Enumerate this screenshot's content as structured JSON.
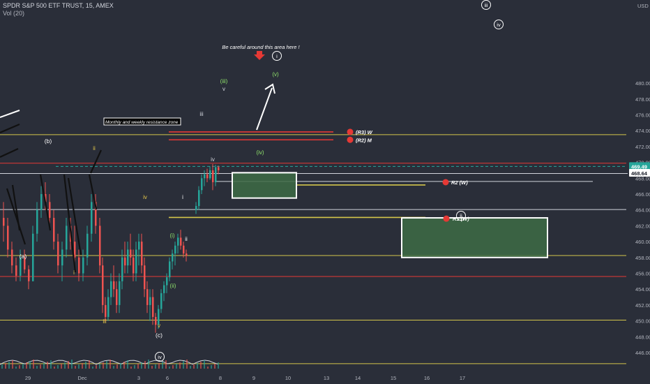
{
  "header": {
    "symbol_line": "SPDR S&P 500 ETF TRUST, 15, AMEX",
    "volume_label": "Vol (20)"
  },
  "colors": {
    "background": "#2a2e39",
    "axis_text": "#b2b5be",
    "yellow_line": "#d4c54a",
    "red_line": "#e53935",
    "white_line": "#d1d4dc",
    "box_fill": "#3d6b45",
    "price_tag": "#26a69a",
    "up_candle": "#26a69a",
    "down_candle": "#ef5350"
  },
  "chart_data": {
    "type": "candlestick",
    "price_axis": {
      "currency": "USD",
      "ticks": [
        446.0,
        448.0,
        450.0,
        452.0,
        454.0,
        456.0,
        458.0,
        460.0,
        462.0,
        464.0,
        466.0,
        468.0,
        470.0,
        472.0,
        474.0,
        476.0,
        478.0,
        480.0
      ],
      "range": [
        444.5,
        481.5
      ]
    },
    "time_axis": {
      "ticks": [
        "29",
        "Dec",
        "3",
        "6",
        "8",
        "9",
        "10",
        "13",
        "14",
        "15",
        "16",
        "17"
      ]
    },
    "price_tags": [
      {
        "value": "469.49",
        "style": "teal"
      },
      {
        "value": "468.64",
        "style": "white"
      }
    ],
    "horizontal_levels": [
      {
        "price": 473.5,
        "color": "yellow"
      },
      {
        "price": 473.85,
        "color": "red",
        "partial": true
      },
      {
        "price": 472.85,
        "color": "red",
        "partial": true
      },
      {
        "price": 469.9,
        "color": "red"
      },
      {
        "price": 469.49,
        "color": "teal-dashed"
      },
      {
        "price": 468.6,
        "color": "white"
      },
      {
        "price": 467.6,
        "color": "white"
      },
      {
        "price": 467.15,
        "color": "yellow",
        "partial": true
      },
      {
        "price": 464.05,
        "color": "white"
      },
      {
        "price": 463.05,
        "color": "yellow",
        "partial": true
      },
      {
        "price": 458.25,
        "color": "yellow"
      },
      {
        "price": 455.6,
        "color": "red"
      },
      {
        "price": 450.1,
        "color": "yellow"
      },
      {
        "price": 444.6,
        "color": "yellow"
      }
    ],
    "zones": [
      {
        "label": "(iv)",
        "price_top": 468.7,
        "price_bottom": 465.5
      },
      {
        "label": "ii",
        "price_top": 463.0,
        "price_bottom": 458.0
      }
    ],
    "annotations": {
      "note": "Be careful around this area here !",
      "resistance": "Monthly and weekly resistance zone",
      "r3w": "(R3) W",
      "r2m": "(R2) M",
      "r2w": "R2 (W)",
      "r1w": "R1 (W)",
      "wave_i_circled": "i",
      "wave_iii_circled": "iii",
      "wave_iv_circled": "iv",
      "wave_v_green": "(v)",
      "wave_iii_green": "(iii)",
      "wave_v_small": "v",
      "wave_iii_small": "iii",
      "wave_iv_small": "iv",
      "wave_b": "(b)",
      "wave_a": "(a)",
      "wave_c": "(c)",
      "wave_ii_yellow": "ii",
      "wave_iv_yellow": "iv",
      "wave_iii_yellow": "iii",
      "wave_v_yellow": "v",
      "wave_i_white": "i",
      "wave_ii_white": "ii",
      "wave_i_green": "(i)",
      "wave_ii_green": "(ii)",
      "wave_iv_vol": "iv"
    }
  }
}
